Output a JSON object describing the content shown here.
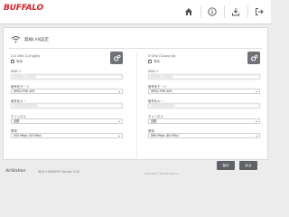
{
  "header": {
    "logo": "BUFFALO",
    "icons": [
      "home-icon",
      "info-icon",
      "download-icon",
      "logout-icon"
    ]
  },
  "page": {
    "title": "無線LAN設定"
  },
  "band24": {
    "label": "2.4 GHz (11n/g/b)",
    "enable_label": "有効",
    "enabled": true,
    "ssid_label": "SSID 1",
    "ssid_value": "Buffalo-G-XXXX",
    "encryption_label": "暗号化モード",
    "encryption_value": "WPA2-PSK AES",
    "key_label": "暗号化キー",
    "key_value": "XXXXXXXXXXXX",
    "channel_label": "チャンネル",
    "channel_value": "自動",
    "bandwidth_label": "帯域",
    "bandwidth_value": "300 Mbps (40 MHz)"
  },
  "band5": {
    "label": "5 GHz (11ac/n/a)",
    "enable_label": "有効",
    "enabled": true,
    "ssid_label": "SSID 1",
    "ssid_value": "Buffalo-A-XXXX",
    "encryption_label": "暗号化モード",
    "encryption_value": "WPA2-PSK AES",
    "key_label": "暗号化キー",
    "key_value": "XXXXXXXXXXXX",
    "channel_label": "チャンネル",
    "channel_value": "自動",
    "bandwidth_label": "帯域",
    "bandwidth_value": "866 Mbps (80 MHz)"
  },
  "footer": {
    "brand": "AirStation",
    "model": "WXR-1900DHP3 Version 2.00",
    "copyright": "Copyright © 2015 Buffalo Inc.",
    "apply_label": "保存",
    "cancel_label": "戻る"
  },
  "colors": {
    "brand_red": "#d2232a",
    "button_gray": "#5f6368"
  }
}
